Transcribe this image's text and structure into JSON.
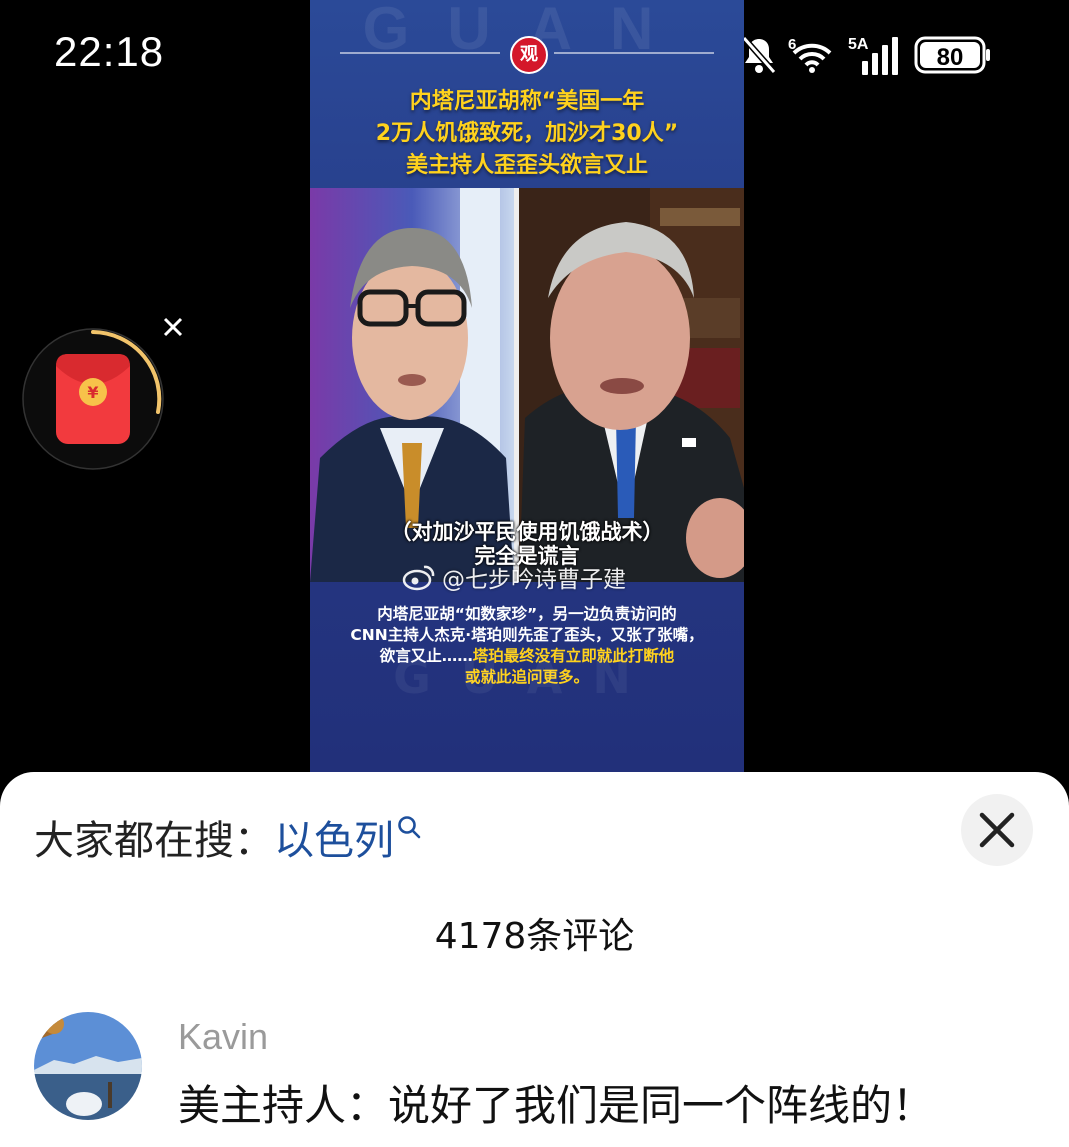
{
  "status_bar": {
    "time": "22:18",
    "icons": [
      "bell-off-icon",
      "wifi-icon",
      "signal-icon",
      "battery-icon"
    ],
    "wifi_badge": "6",
    "signal_badge": "5A",
    "battery_level": "80"
  },
  "video": {
    "logo_text": "观",
    "watermark": "GUAN",
    "headline_lines": [
      "内塔尼亚胡称“美国一年",
      "2万人饥饿致死，加沙才30人”",
      "美主持人歪歪头欲言又止"
    ],
    "subtitle_lines": [
      "（对加沙平民使用饥饿战术）",
      "完全是谎言"
    ],
    "weibo_handle": "@七步吟诗曹子建",
    "caption_lines": [
      "内塔尼亚胡“如数家珍”，另一边负责访问的",
      "CNN主持人杰克·塔珀则先歪了歪头，又张了张嘴，"
    ],
    "caption_line3_plain": "欲言又止……",
    "caption_line3_highlight": "塔珀最终没有立即就此打断他",
    "caption_line4_highlight": "或就此追问更多。",
    "colors": {
      "highlight": "#ffd21d",
      "background": "#263a86"
    }
  },
  "red_packet": {
    "icon": "red-envelope-icon",
    "close_icon": "close-icon",
    "symbol": "¥"
  },
  "sheet": {
    "search_prefix": "大家都在搜：",
    "search_term": "以色列",
    "comments_count": "4178条评论",
    "comments": [
      {
        "user": "Kavin",
        "text": "美主持人：说好了我们是同一个阵线的！"
      }
    ],
    "colors": {
      "search_term": "#1d4f9c"
    }
  }
}
